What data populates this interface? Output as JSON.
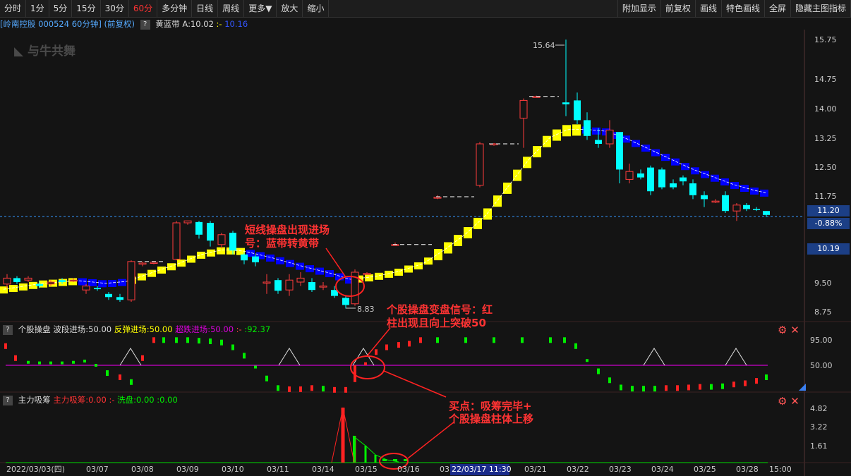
{
  "toolbar": {
    "left": [
      "分时",
      "1分",
      "5分",
      "15分",
      "30分",
      "60分",
      "多分钟",
      "日线",
      "周线",
      "更多▼",
      "放大",
      "缩小"
    ],
    "active": "60分",
    "right": [
      "附加显示",
      "前复权",
      "画线",
      "特色画线",
      "全屏",
      "隐藏主图指标"
    ]
  },
  "header": {
    "stock": "[岭南控股 000524 60分钟] (前复权)",
    "indicator": "黄蓝带 A:10.02",
    "ind_suffix": ":-",
    "ind_value": "10.16",
    "watermark": "与牛共舞"
  },
  "price_axis": [
    "15.75",
    "14.75",
    "14.00",
    "13.25",
    "12.50",
    "11.75",
    "11.20",
    "-0.88%",
    "10.19",
    "9.50",
    "8.75"
  ],
  "sub1": {
    "name": "个股操盘",
    "wave": "波段进场:50.00",
    "rebound": "反弹进场:50.00",
    "oversold": "超跌进场:50.00",
    "last": ":92.37",
    "axis": [
      "95.00",
      "50.00"
    ]
  },
  "sub2": {
    "name": "主力吸筹",
    "main": "主力吸筹:0.00",
    "wash": "洗盘:0.00",
    "last": ":0.00",
    "axis": [
      "4.82",
      "3.22",
      "1.61"
    ]
  },
  "dates": [
    "2022/03/03(四)",
    "03/07",
    "03/08",
    "03/09",
    "03/10",
    "03/11",
    "03/14",
    "03/15",
    "03/16",
    "03/22",
    "03/23",
    "03/24",
    "03/25",
    "03/28"
  ],
  "cursor_date": "22/03/17 11:30",
  "cursor_label": "03/21",
  "time_label": "15:00",
  "annotations": {
    "a1_l1": "短线操盘出现进场",
    "a1_l2": "号：蓝带转黄带",
    "a2_l1": "个股操盘变盘信号：红",
    "a2_l2": "柱出现且向上突破50",
    "a3_l1": "买点：吸筹完毕+",
    "a3_l2": "个股操盘柱体上移",
    "high": "15.64",
    "low": "8.83"
  },
  "colors": {
    "up": "#ff3c3c",
    "down": "#00ffff",
    "yellow": "#ffff00",
    "blue": "#0000ff",
    "green": "#00ee00",
    "red": "#ff2222",
    "magenta": "#cc00cc"
  }
}
